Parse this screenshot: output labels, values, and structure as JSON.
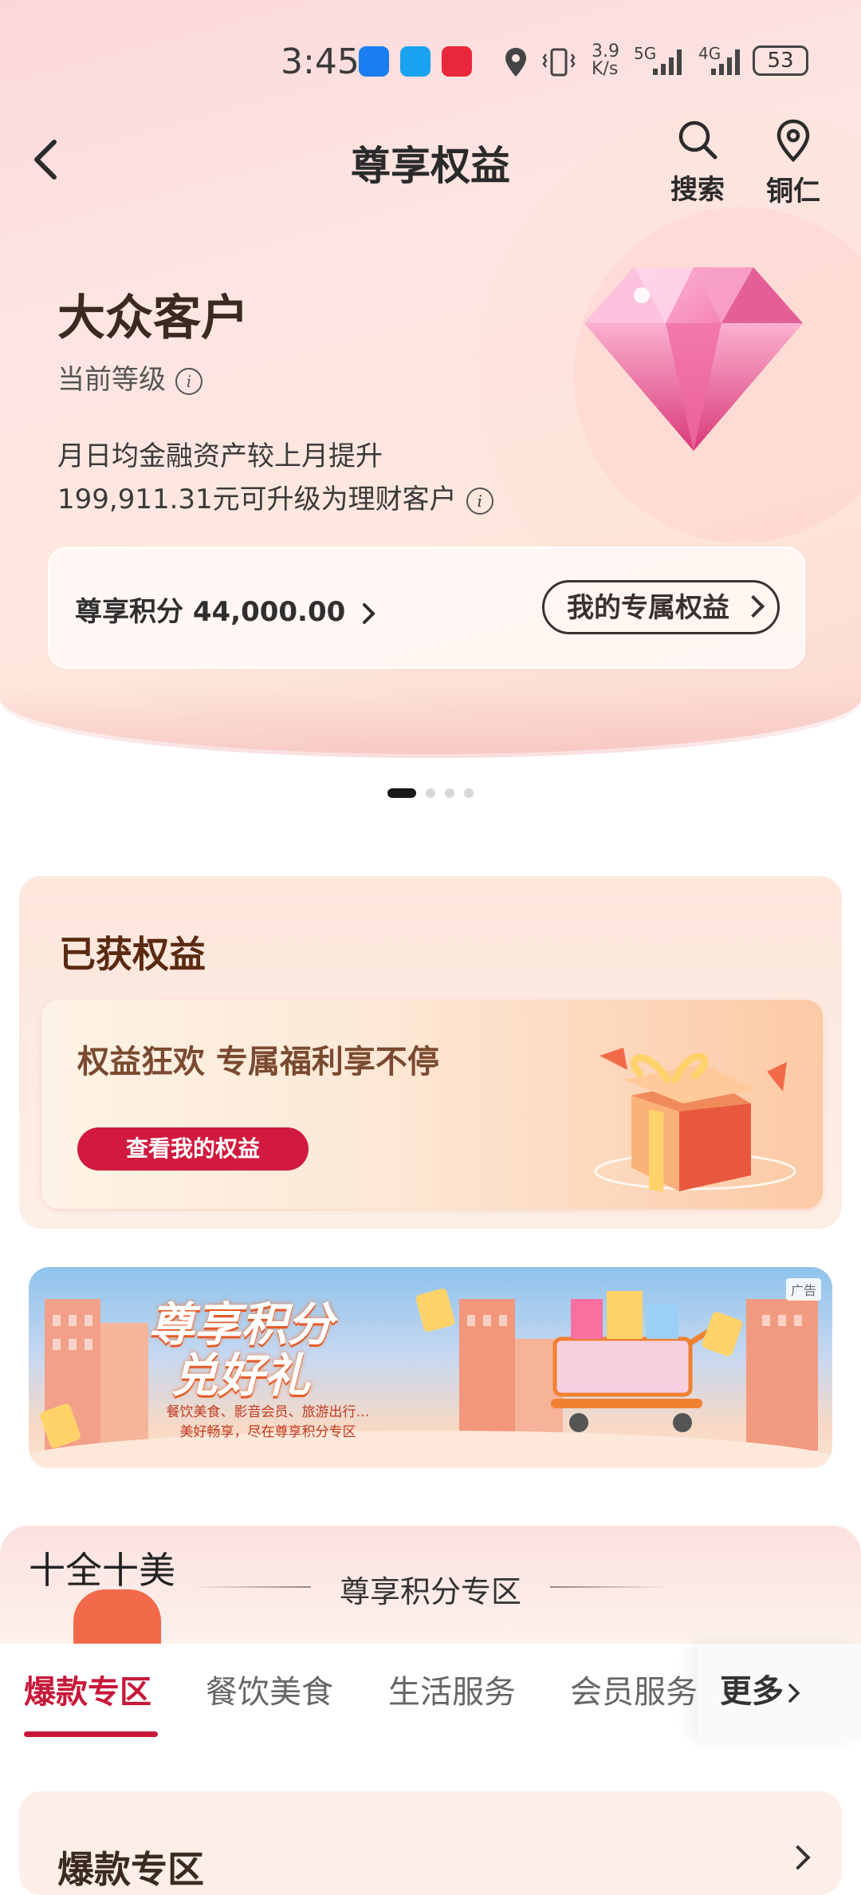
{
  "status_bar": {
    "time": "3:45",
    "net_speed_value": "3.9",
    "net_speed_unit": "K/s",
    "signal_1": "5G",
    "signal_2": "4G",
    "battery": "53"
  },
  "header": {
    "title": "尊享权益",
    "search_label": "搜索",
    "location_label": "铜仁"
  },
  "level_card": {
    "level_name": "大众客户",
    "current_level_label": "当前等级",
    "upgrade_line1": "月日均金融资产较上月提升",
    "upgrade_line2": "199,911.31元可升级为理财客户",
    "points_label": "尊享积分 44,000.00",
    "my_benefits_button": "我的专属权益"
  },
  "carousel": {
    "count": 4,
    "active_index": 0
  },
  "obtained": {
    "title": "已获权益",
    "slogan": "权益狂欢 专属福利享不停",
    "button": "查看我的权益"
  },
  "banner": {
    "title_line1": "尊享积分",
    "title_line2": "兑好礼",
    "sub_line1": "餐饮美食、影音会员、旅游出行…",
    "sub_line2": "美好畅享，尽在尊享积分专区",
    "ad_tag": "广告"
  },
  "zone": {
    "decor_text": "十全十美",
    "title": "尊享积分专区",
    "tabs": [
      {
        "label": "爆款专区",
        "active": true
      },
      {
        "label": "餐饮美食",
        "active": false
      },
      {
        "label": "生活服务",
        "active": false
      },
      {
        "label": "会员服务",
        "active": false
      }
    ],
    "more_label": "更多",
    "section_title": "爆款专区"
  },
  "icons": {
    "back": "chevron-left-icon",
    "search": "search-icon",
    "location": "location-pin-icon",
    "info": "info-icon",
    "diamond": "diamond-icon",
    "gift": "gift-box-icon"
  },
  "colors": {
    "accent_red": "#c8183a",
    "button_red": "#d11a3e",
    "title_brown": "#5a2a10"
  }
}
